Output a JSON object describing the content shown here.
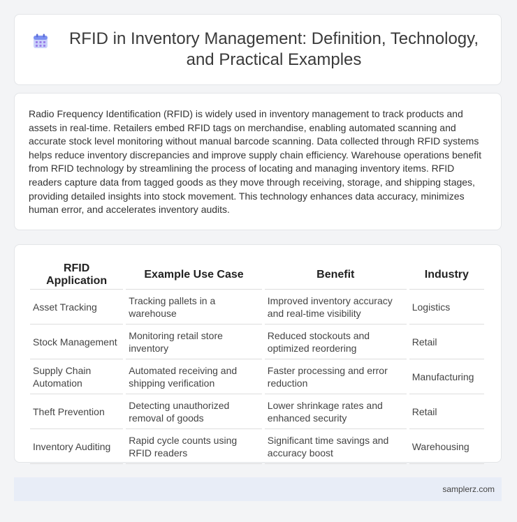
{
  "header": {
    "title": "RFID in Inventory Management: Definition, Technology, and Practical Examples",
    "icon": "calendar-icon"
  },
  "intro": {
    "text": "Radio Frequency Identification (RFID) is widely used in inventory management to track products and assets in real-time. Retailers embed RFID tags on merchandise, enabling automated scanning and accurate stock level monitoring without manual barcode scanning. Data collected through RFID systems helps reduce inventory discrepancies and improve supply chain efficiency. Warehouse operations benefit from RFID technology by streamlining the process of locating and managing inventory items. RFID readers capture data from tagged goods as they move through receiving, storage, and shipping stages, providing detailed insights into stock movement. This technology enhances data accuracy, minimizes human error, and accelerates inventory audits."
  },
  "table": {
    "headers": [
      "RFID Application",
      "Example Use Case",
      "Benefit",
      "Industry"
    ],
    "rows": [
      [
        "Asset Tracking",
        "Tracking pallets in a warehouse",
        "Improved inventory accuracy and real-time visibility",
        "Logistics"
      ],
      [
        "Stock Management",
        "Monitoring retail store inventory",
        "Reduced stockouts and optimized reordering",
        "Retail"
      ],
      [
        "Supply Chain Automation",
        "Automated receiving and shipping verification",
        "Faster processing and error reduction",
        "Manufacturing"
      ],
      [
        "Theft Prevention",
        "Detecting unauthorized removal of goods",
        "Lower shrinkage rates and enhanced security",
        "Retail"
      ],
      [
        "Inventory Auditing",
        "Rapid cycle counts using RFID readers",
        "Significant time savings and accuracy boost",
        "Warehousing"
      ]
    ]
  },
  "footer": {
    "site": "samplerz.com"
  },
  "colors": {
    "icon_accent": "#7b8ff0",
    "footer_bg": "#e8edf7"
  }
}
